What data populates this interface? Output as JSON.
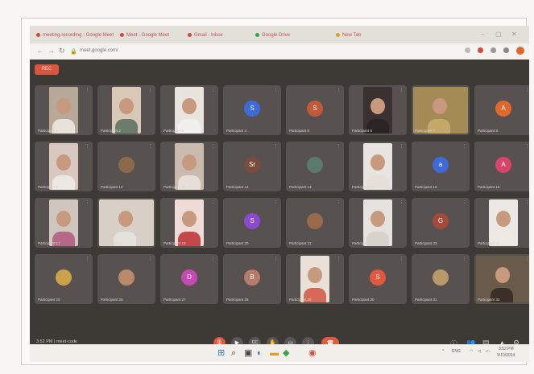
{
  "browser": {
    "tabs": [
      {
        "label": "meeting-recording - Google Meet",
        "color": "#d24a3b"
      },
      {
        "label": "Meet - Google Meet",
        "color": "#d24a3b"
      },
      {
        "label": "Gmail - Inbox",
        "color": "#d24a3b"
      },
      {
        "label": "Google Drive",
        "color": "#3aa34a"
      },
      {
        "label": "New Tab",
        "color": "#e0a030"
      }
    ],
    "url": "meet.google.com/"
  },
  "meeting": {
    "recording_badge": "REC",
    "clock": "3:52 PM  |  meet-code",
    "tiles": [
      {
        "name": "Participant 1",
        "type": "video",
        "bg": "#b7a999",
        "shirt": "#e8e2da"
      },
      {
        "name": "Participant 2",
        "type": "video",
        "bg": "#d7c9b5",
        "shirt": "#6c7c6a"
      },
      {
        "name": "Participant 3",
        "type": "video",
        "bg": "#e9e4de",
        "shirt": "#f2f0ec"
      },
      {
        "name": "Participant 4",
        "type": "avatar",
        "initial": "S",
        "color": "#3f6bd8"
      },
      {
        "name": "Participant 5",
        "type": "avatar",
        "initial": "S",
        "color": "#c25a3a"
      },
      {
        "name": "Participant 6",
        "type": "video",
        "bg": "#3a3230",
        "shirt": "#2a2422"
      },
      {
        "name": "Participant 7",
        "type": "wide",
        "bg": "#a48a55",
        "shirt": "#c4a86a"
      },
      {
        "name": "Participant 8",
        "type": "avatar",
        "initial": "A",
        "color": "#e0672e"
      },
      {
        "name": "Participant 9",
        "type": "video",
        "bg": "#d8c8c0",
        "shirt": "#ece7e2"
      },
      {
        "name": "Participant 10",
        "type": "avatar",
        "initial": "",
        "color": "#8a6a4a"
      },
      {
        "name": "Participant 11",
        "type": "video",
        "bg": "#c9bcae",
        "shirt": "#e5dfd6"
      },
      {
        "name": "Participant 12",
        "type": "avatar",
        "initial": "Sr",
        "color": "#7a4c3c"
      },
      {
        "name": "Participant 13",
        "type": "avatar",
        "initial": "",
        "color": "#5a7a6a"
      },
      {
        "name": "Participant 14",
        "type": "video",
        "bg": "#e8e4e0",
        "shirt": "#e6e0da"
      },
      {
        "name": "Participant 15",
        "type": "avatar",
        "initial": "a",
        "color": "#3f6bd8"
      },
      {
        "name": "Participant 16",
        "type": "avatar",
        "initial": "A",
        "color": "#d8456a"
      },
      {
        "name": "Participant 17",
        "type": "video",
        "bg": "#cfc6be",
        "shirt": "#b46a86"
      },
      {
        "name": "Participant 18",
        "type": "wide",
        "bg": "#d8d0c6",
        "shirt": "#e5e2dc"
      },
      {
        "name": "Participant 19",
        "type": "video",
        "bg": "#f0dcd6",
        "shirt": "#c2484a"
      },
      {
        "name": "Participant 20",
        "type": "avatar",
        "initial": "S",
        "color": "#8a4ad0"
      },
      {
        "name": "Participant 21",
        "type": "avatar",
        "initial": "",
        "color": "#9a6a4a"
      },
      {
        "name": "Participant 22",
        "type": "video",
        "bg": "#e6e2de",
        "shirt": "#d8d2cc"
      },
      {
        "name": "Participant 23",
        "type": "avatar",
        "initial": "G",
        "color": "#a44a3a"
      },
      {
        "name": "Participant 24",
        "type": "video",
        "bg": "#ece8e4",
        "shirt": "#efe9e3"
      },
      {
        "name": "Participant 25",
        "type": "avatar",
        "initial": "",
        "color": "#caa24a"
      },
      {
        "name": "Participant 26",
        "type": "avatar",
        "initial": "",
        "color": "#b88a6a"
      },
      {
        "name": "Participant 27",
        "type": "avatar",
        "initial": "D",
        "color": "#c24ab0"
      },
      {
        "name": "Participant 28",
        "type": "avatar",
        "initial": "B",
        "color": "#b87a6a"
      },
      {
        "name": "Participant 29",
        "type": "video",
        "bg": "#e9e1d8",
        "shirt": "#d46a5a"
      },
      {
        "name": "Participant 30",
        "type": "avatar",
        "initial": "S",
        "color": "#e0593f"
      },
      {
        "name": "Participant 31",
        "type": "avatar",
        "initial": "",
        "color": "#b89a6a"
      },
      {
        "name": "Participant 32",
        "type": "wide",
        "bg": "#6a5a4a",
        "shirt": "#3a3028"
      }
    ]
  },
  "controls": {
    "mic": "🎙",
    "camera": "▶",
    "captions": "CC",
    "hand": "✋",
    "present": "▭",
    "more": "⋮",
    "leave": "☎"
  },
  "taskbar": {
    "time": "3:52 PM",
    "date": "9/10/2024",
    "lang": "ENG"
  }
}
